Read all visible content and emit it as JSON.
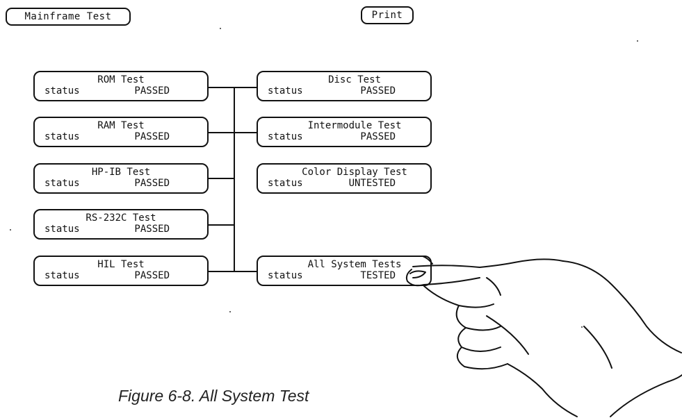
{
  "header": {
    "mainframe_label": "Mainframe Test",
    "print_label": "Print"
  },
  "left_tests": [
    {
      "name": "ROM Test",
      "status_label": "status",
      "status": "PASSED"
    },
    {
      "name": "RAM Test",
      "status_label": "status",
      "status": "PASSED"
    },
    {
      "name": "HP-IB Test",
      "status_label": "status",
      "status": "PASSED"
    },
    {
      "name": "RS-232C Test",
      "status_label": "status",
      "status": "PASSED"
    },
    {
      "name": "HIL Test",
      "status_label": "status",
      "status": "PASSED"
    }
  ],
  "right_tests": [
    {
      "name": "Disc Test",
      "status_label": "status",
      "status": "PASSED"
    },
    {
      "name": "Intermodule Test",
      "status_label": "status",
      "status": "PASSED"
    },
    {
      "name": "Color Display Test",
      "status_label": "status",
      "status": "UNTESTED"
    },
    {
      "name": "All System Tests",
      "status_label": "status",
      "status": "TESTED"
    }
  ],
  "caption": "Figure 6-8. All System Test",
  "colors": {
    "ink": "#111111",
    "background": "#ffffff"
  },
  "icons": [
    "pointing-hand-icon"
  ]
}
